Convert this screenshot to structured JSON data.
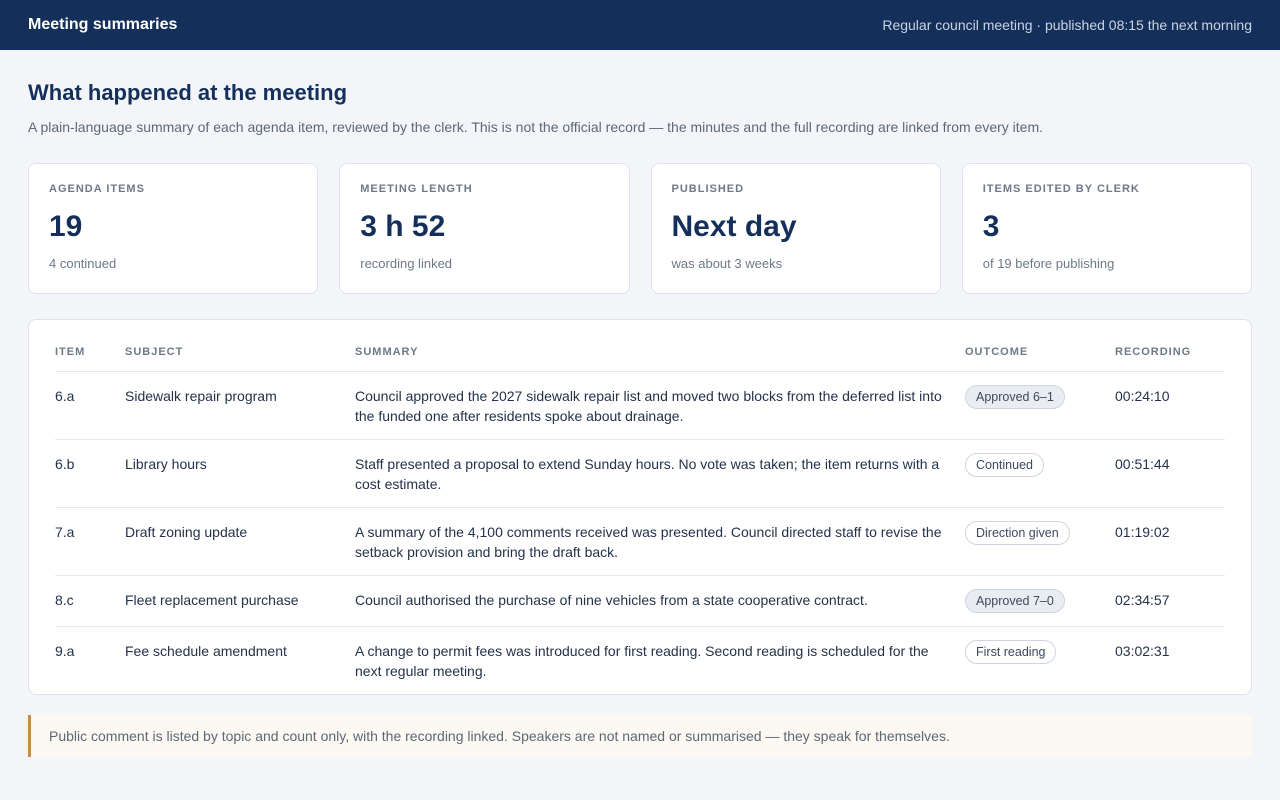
{
  "header": {
    "app_title": "Meeting summaries",
    "meta": "Regular council meeting · published 08:15 the next morning"
  },
  "page": {
    "title": "What happened at the meeting",
    "intro": "A plain-language summary of each agenda item, reviewed by the clerk. This is not the official record — the minutes and the full recording are linked from every item."
  },
  "stats": [
    {
      "label": "AGENDA ITEMS",
      "value": "19",
      "sub": "4 continued"
    },
    {
      "label": "MEETING LENGTH",
      "value": "3 h 52",
      "sub": "recording linked"
    },
    {
      "label": "PUBLISHED",
      "value": "Next day",
      "sub": "was about 3 weeks"
    },
    {
      "label": "ITEMS EDITED BY CLERK",
      "value": "3",
      "sub": "of 19 before publishing"
    }
  ],
  "table": {
    "columns": [
      "ITEM",
      "SUBJECT",
      "SUMMARY",
      "OUTCOME",
      "RECORDING"
    ],
    "rows": [
      {
        "item": "6.a",
        "subject": "Sidewalk repair program",
        "summary": "Council approved the 2027 sidewalk repair list and moved two blocks from the deferred list into the funded one after residents spoke about drainage.",
        "outcome": "Approved 6–1",
        "recording": "00:24:10"
      },
      {
        "item": "6.b",
        "subject": "Library hours",
        "summary": "Staff presented a proposal to extend Sunday hours. No vote was taken; the item returns with a cost estimate.",
        "outcome": "Continued",
        "recording": "00:51:44"
      },
      {
        "item": "7.a",
        "subject": "Draft zoning update",
        "summary": "A summary of the 4,100 comments received was presented. Council directed staff to revise the setback provision and bring the draft back.",
        "outcome": "Direction given",
        "recording": "01:19:02"
      },
      {
        "item": "8.c",
        "subject": "Fleet replacement purchase",
        "summary": "Council authorised the purchase of nine vehicles from a state cooperative contract.",
        "outcome": "Approved 7–0",
        "recording": "02:34:57"
      },
      {
        "item": "9.a",
        "subject": "Fee schedule amendment",
        "summary": "A change to permit fees was introduced for first reading. Second reading is scheduled for the next regular meeting.",
        "outcome": "First reading",
        "recording": "03:02:31"
      }
    ]
  },
  "note": "Public comment is listed by topic and count only, with the recording linked. Speakers are not named or summarised — they speak for themselves."
}
